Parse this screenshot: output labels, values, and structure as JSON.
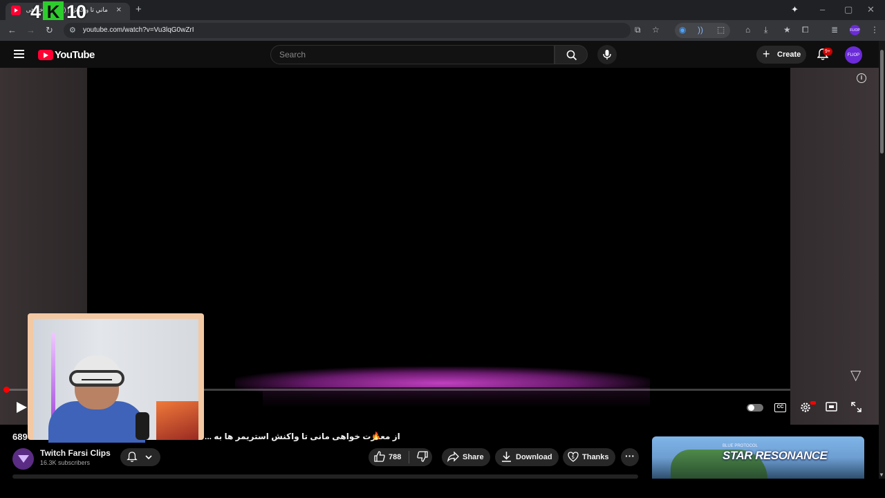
{
  "browser": {
    "tab_title": "ماني تا واكنش | (30) عذرخواهی ...",
    "new_tab": "+",
    "tab_close": "×",
    "url": "youtube.com/watch?v=Vu3lqG0wZrI",
    "watermark_left": "4",
    "watermark_k": "K",
    "watermark_right": "10",
    "profile": "FLIOP"
  },
  "youtube": {
    "logo": "YouTube",
    "search_placeholder": "Search",
    "create_label": "Create",
    "notifications_badge": "9+",
    "avatar_text": "FLIOP"
  },
  "video": {
    "title_views": "689",
    "title": "از معذرت خواهی مانی تا واکنش استریمر ها به ...",
    "fire": "🔥",
    "cc_label": "CC"
  },
  "channel": {
    "name": "Twitch Farsi Clips",
    "subscribers": "16.3K subscribers"
  },
  "actions": {
    "likes": "788",
    "share": "Share",
    "download": "Download",
    "thanks": "Thanks",
    "more": "···"
  },
  "ad": {
    "title": "STAR RESONANCE",
    "subtitle": "BLUE PROTOCOL"
  },
  "colors": {
    "brand_red": "#ff0033",
    "background": "#0f0f0f",
    "pill": "#272727",
    "accent_purple": "#6b2bd8"
  }
}
